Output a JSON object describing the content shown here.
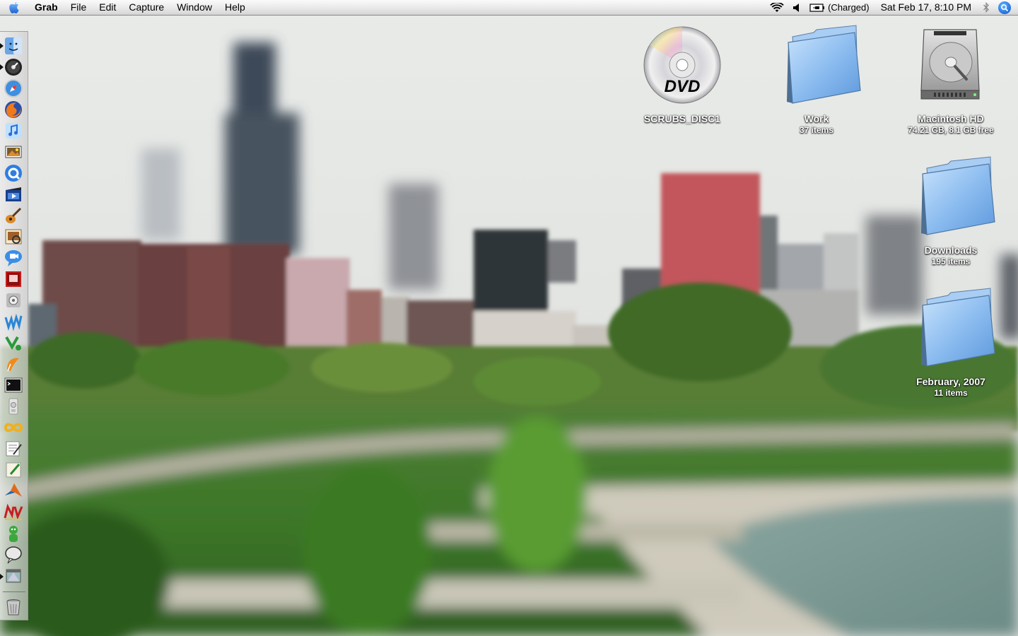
{
  "menubar": {
    "app_name": "Grab",
    "menus": [
      "File",
      "Edit",
      "Capture",
      "Window",
      "Help"
    ],
    "battery_status": "(Charged)",
    "clock": "Sat Feb 17, 8:10 PM"
  },
  "dock": {
    "items": [
      {
        "name": "finder",
        "running": true
      },
      {
        "name": "dashboard",
        "running": true
      },
      {
        "name": "safari",
        "running": false
      },
      {
        "name": "firefox",
        "running": false
      },
      {
        "name": "itunes",
        "running": false
      },
      {
        "name": "iphoto",
        "running": false
      },
      {
        "name": "quicktime",
        "running": false
      },
      {
        "name": "imovie",
        "running": false
      },
      {
        "name": "garageband",
        "running": false
      },
      {
        "name": "preview",
        "running": false
      },
      {
        "name": "ichat",
        "running": false
      },
      {
        "name": "photo-booth",
        "running": false
      },
      {
        "name": "system-preferences",
        "running": false
      },
      {
        "name": "dreamweaver",
        "running": false
      },
      {
        "name": "vectorworks",
        "running": false
      },
      {
        "name": "pages",
        "running": false
      },
      {
        "name": "terminal",
        "running": false
      },
      {
        "name": "grab",
        "running": true
      },
      {
        "name": "infinity-app",
        "running": false
      },
      {
        "name": "textedit",
        "running": false
      },
      {
        "name": "script-editor",
        "running": false
      },
      {
        "name": "matlab",
        "running": false
      },
      {
        "name": "nvu",
        "running": false
      },
      {
        "name": "adium",
        "running": false
      },
      {
        "name": "speech-bubble-app",
        "running": false
      },
      {
        "name": "downloads-stack",
        "running": false
      },
      {
        "name": "trash",
        "running": false
      }
    ]
  },
  "desktop": {
    "dvd": {
      "label": "SCRUBS_DISC1",
      "disc_text": "DVD"
    },
    "work": {
      "label": "Work",
      "info": "37 items"
    },
    "hd": {
      "label": "Macintosh HD",
      "info": "74.21 GB, 8.1 GB free"
    },
    "downloads": {
      "label": "Downloads",
      "info": "195 items"
    },
    "february": {
      "label": "February, 2007",
      "info": "11 items"
    }
  },
  "colors": {
    "menubar_bg": "#e8e8e8",
    "folder_blue": "#7fb6ec",
    "sky": "#e2e4e2",
    "grass": "#3f7a2a",
    "water": "#7e9a94"
  }
}
